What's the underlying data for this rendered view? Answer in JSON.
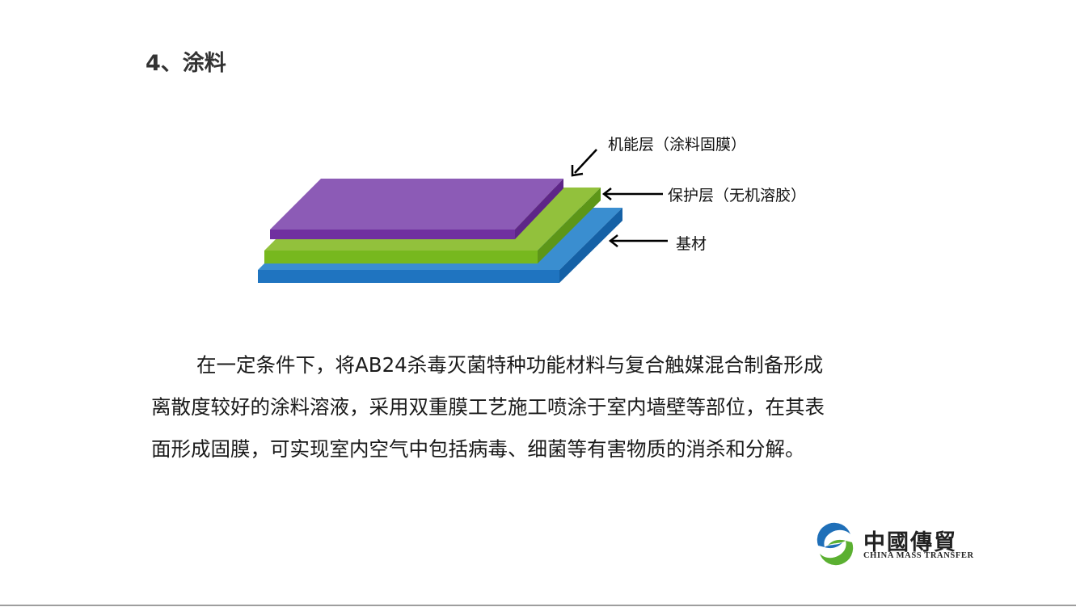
{
  "page": {
    "title": "4、涂料"
  },
  "diagram": {
    "layers": [
      {
        "label": "机能层（涂料固膜）",
        "top_color": "#8c5bb6",
        "front_color": "#7030a0",
        "side_color": "#5e2688"
      },
      {
        "label": "保护层（无机溶胶）",
        "top_color": "#92c13c",
        "front_color": "#77b81e",
        "side_color": "#5d9618"
      },
      {
        "label": "基材",
        "top_color": "#3a8ed0",
        "front_color": "#1f74c0",
        "side_color": "#1561a6"
      }
    ]
  },
  "paragraph": {
    "lines": [
      "在一定条件下，将AB24杀毒灭菌特种功能材料与复合触媒混合制备形成",
      "离散度较好的涂料溶液，采用双重膜工艺施工喷涂于室内墙壁等部位，在其表",
      "面形成固膜，可实现室内空气中包括病毒、细菌等有害物质的消杀和分解。"
    ]
  },
  "logo": {
    "name_cn": "中國傳貿",
    "name_en": "CHINA MASS TRANSFER",
    "colors": {
      "blue": "#1f6fb8",
      "green": "#5bb031"
    }
  }
}
